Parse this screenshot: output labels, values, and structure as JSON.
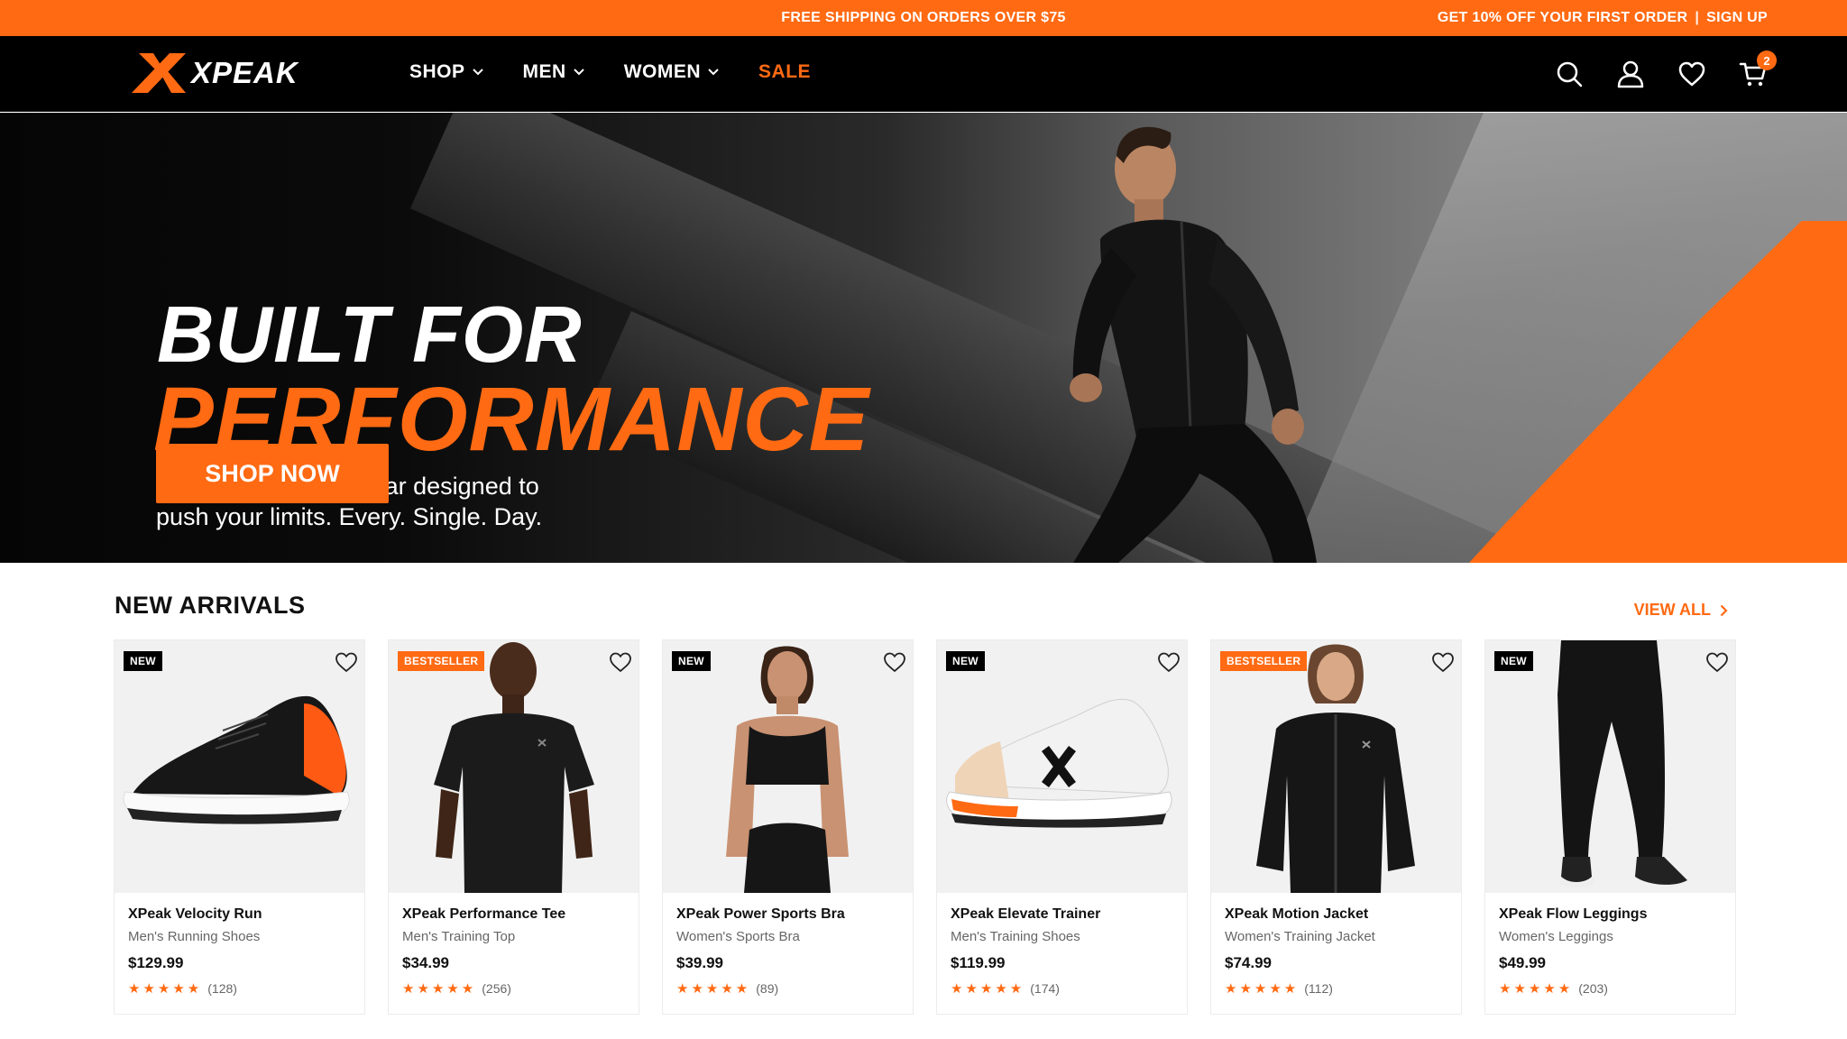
{
  "promo": {
    "center": "FREE SHIPPING ON ORDERS OVER $75",
    "right_offer": "GET 10% OFF YOUR FIRST ORDER",
    "separator": "|",
    "right_link": "SIGN UP"
  },
  "header": {
    "logo_text": "XPEAK",
    "nav": [
      "SHOP",
      "MEN",
      "WOMEN",
      "SALE"
    ],
    "cart_count": "2"
  },
  "hero": {
    "title_line1": "BUILT FOR",
    "title_line2": "PERFORMANCE",
    "subtitle_line1": "High-performance gear designed to",
    "subtitle_line2": "push your limits. Every. Single. Day.",
    "cta": "SHOP NOW"
  },
  "arrivals": {
    "title": "NEW ARRIVALS",
    "view_all": "VIEW ALL",
    "products": [
      {
        "tag": "NEW",
        "name": "XPeak Velocity Run",
        "category": "Men's Running Shoes",
        "price": "$129.99",
        "reviews": "(128)",
        "rating": 5
      },
      {
        "tag": "BESTSELLER",
        "name": "XPeak Performance Tee",
        "category": "Men's Training Top",
        "price": "$34.99",
        "reviews": "(256)",
        "rating": 5
      },
      {
        "tag": "NEW",
        "name": "XPeak Power Sports Bra",
        "category": "Women's Sports Bra",
        "price": "$39.99",
        "reviews": "(89)",
        "rating": 5
      },
      {
        "tag": "NEW",
        "name": "XPeak Elevate Trainer",
        "category": "Men's Training Shoes",
        "price": "$119.99",
        "reviews": "(174)",
        "rating": 5
      },
      {
        "tag": "BESTSELLER",
        "name": "XPeak Motion Jacket",
        "category": "Women's Training Jacket",
        "price": "$74.99",
        "reviews": "(112)",
        "rating": 5
      },
      {
        "tag": "NEW",
        "name": "XPeak Flow Leggings",
        "category": "Women's Leggings",
        "price": "$49.99",
        "reviews": "(203)",
        "rating": 5
      }
    ]
  },
  "colors": {
    "accent": "#ff6a13",
    "header_bg": "#000000"
  }
}
